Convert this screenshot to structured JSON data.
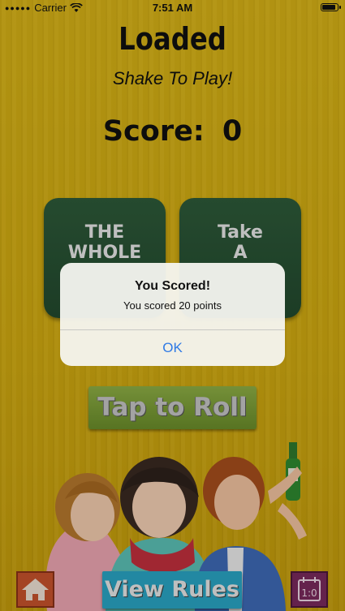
{
  "status_bar": {
    "carrier": "Carrier",
    "time": "7:51 AM",
    "battery_level": 0.95
  },
  "header": {
    "title": "Loaded",
    "subtitle": "Shake To Play!"
  },
  "score": {
    "label": "Score:",
    "value": "0"
  },
  "cards": [
    {
      "text": "THE\nWHOLE"
    },
    {
      "text": "Take\nA"
    }
  ],
  "roll_button": {
    "label": "Tap to Roll"
  },
  "bottom_bar": {
    "home_icon": "home-icon",
    "rules_label": "View Rules",
    "calendar_icon": "calendar-icon",
    "calendar_text": "1:0"
  },
  "alert": {
    "title": "You Scored!",
    "message": "You scored 20 points",
    "ok_label": "OK"
  },
  "colors": {
    "background": "#d9b312",
    "card": "#2e5b3a",
    "roll_button": "#7ea03a",
    "rules_button": "#2aa7c6",
    "home_button": "#c9542c",
    "calendar_button": "#7b2a5d",
    "alert_action": "#2f7ae5"
  }
}
